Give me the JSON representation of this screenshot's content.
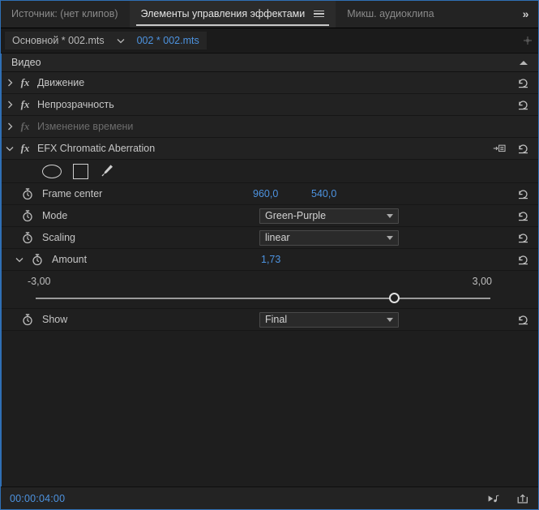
{
  "panel_tabs": [
    {
      "label": "Источник: (нет клипов)",
      "active": false
    },
    {
      "label": "Элементы управления эффектами",
      "active": true
    },
    {
      "label": "Микш. аудиоклипа",
      "active": false
    }
  ],
  "panel_menu_icon": "hamburger-menu-icon",
  "overflow_label": "»",
  "sequence_bar": {
    "master_clip": "Основной * 002.mts",
    "chevron_icon": "chevron-down-icon",
    "current_clip": "002 * 002.mts",
    "grip_icon": "drag-grip-icon"
  },
  "group": {
    "label": "Видео",
    "collapse_icon": "triangle-up-icon"
  },
  "effects": [
    {
      "name": "Движение",
      "expand_icon": "chevron-right-icon",
      "fx_badge": "fx",
      "dim": false,
      "reset_icon": "reset-icon"
    },
    {
      "name": "Непрозрачность",
      "expand_icon": "chevron-right-icon",
      "fx_badge": "fx",
      "dim": false,
      "reset_icon": "reset-icon"
    },
    {
      "name": "Изменение времени",
      "expand_icon": "chevron-right-icon",
      "fx_badge": "fx",
      "dim": true,
      "reset_icon": ""
    }
  ],
  "chromatic_effect": {
    "name": "EFX Chromatic Aberration",
    "expand_icon": "chevron-down-icon",
    "fx_badge": "fx",
    "keyframe_nav_icon": "arrow-to-box-icon",
    "reset_icon": "reset-icon",
    "mask_tools": [
      {
        "icon": "ellipse-mask-icon"
      },
      {
        "icon": "rectangle-mask-icon"
      },
      {
        "icon": "pen-mask-icon"
      }
    ],
    "params": [
      {
        "label": "Frame center",
        "stopwatch_icon": "stopwatch-icon",
        "value_x": "960,0",
        "value_y": "540,0",
        "reset_icon": "reset-icon"
      },
      {
        "label": "Mode",
        "stopwatch_icon": "stopwatch-icon",
        "value": "Green-Purple",
        "caret_icon": "chevron-down-icon",
        "reset_icon": "reset-icon"
      },
      {
        "label": "Scaling",
        "stopwatch_icon": "stopwatch-icon",
        "value": "linear",
        "caret_icon": "chevron-down-icon",
        "reset_icon": "reset-icon"
      },
      {
        "label": "Amount",
        "expand_icon": "chevron-down-icon",
        "stopwatch_icon": "stopwatch-icon",
        "value": "1,73",
        "reset_icon": "reset-icon"
      }
    ],
    "slider": {
      "min_label": "-3,00",
      "max_label": "3,00",
      "min": -3.0,
      "max": 3.0,
      "value": 1.73,
      "thumb_icon": "slider-thumb-icon"
    },
    "show_param": {
      "label": "Show",
      "stopwatch_icon": "stopwatch-icon",
      "value": "Final",
      "caret_icon": "chevron-down-icon",
      "reset_icon": "reset-icon"
    }
  },
  "statusbar": {
    "timecode": "00:00:04:00",
    "icons": [
      {
        "name": "play-audio-icon"
      },
      {
        "name": "export-frame-icon"
      }
    ]
  },
  "colors": {
    "accent_blue": "#4d93e0",
    "panel_border": "#2f6fb5",
    "panel_bg": "#1e1e1e",
    "row_bg": "#222222",
    "text": "#c8c8c8"
  }
}
